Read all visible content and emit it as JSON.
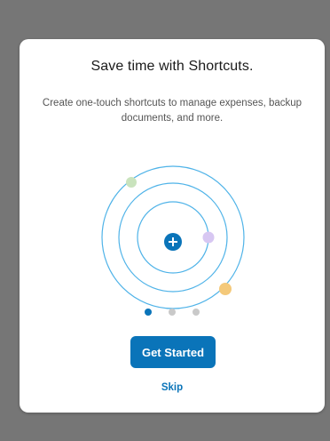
{
  "dialog": {
    "title": "Save time with Shortcuts.",
    "description": "Create one-touch shortcuts to manage expenses, backup documents, and more.",
    "primary_button": "Get Started",
    "secondary_link": "Skip"
  },
  "pager": {
    "total": 3,
    "current": 1
  },
  "illustration": {
    "icon": "plus-icon",
    "colors": {
      "ring": "#4fb3e8",
      "center": "#0a74b9",
      "orbit_green": "#c9e3bd",
      "orbit_purple": "#d7c7f2",
      "orbit_yellow": "#f4c97a"
    }
  },
  "colors": {
    "accent": "#0a74b9",
    "backdrop": "#767676",
    "card": "#ffffff"
  }
}
